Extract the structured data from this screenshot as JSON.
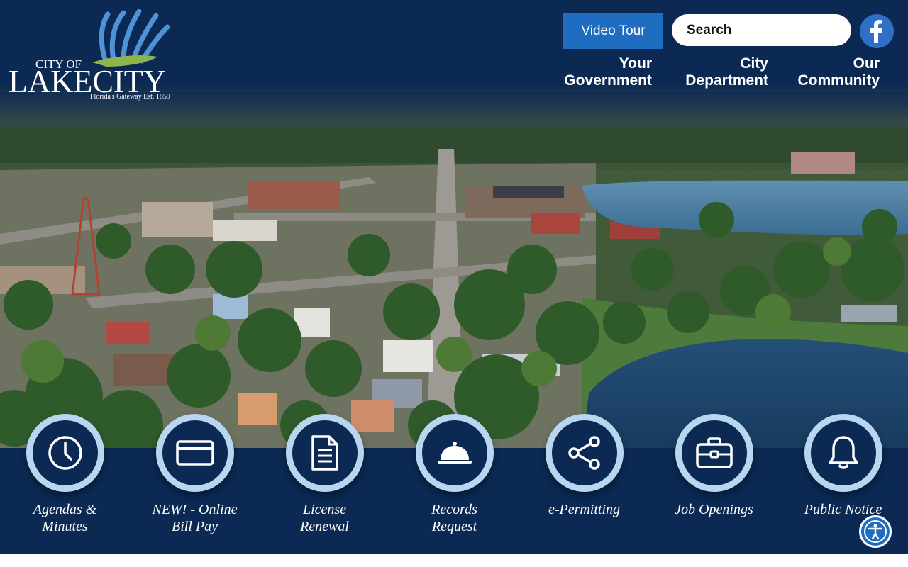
{
  "logo": {
    "line1": "CITY OF",
    "line2": "LAKECITY",
    "tagline": "Florida's Gateway Est. 1859"
  },
  "header": {
    "video_tour": "Video Tour",
    "search_placeholder": "Search",
    "facebook_icon": "facebook-icon",
    "search_icon": "search-icon"
  },
  "nav": [
    {
      "line1": "Your",
      "line2": "Government"
    },
    {
      "line1": "City",
      "line2": "Department"
    },
    {
      "line1": "Our",
      "line2": "Community"
    }
  ],
  "quick_links": [
    {
      "line1": "Agendas &",
      "line2": "Minutes",
      "icon": "clock-icon"
    },
    {
      "line1": "NEW! - Online",
      "line2": "Bill Pay",
      "icon": "credit-card-icon"
    },
    {
      "line1": "License",
      "line2": "Renewal",
      "icon": "document-icon"
    },
    {
      "line1": "Records",
      "line2": "Request",
      "icon": "service-bell-icon"
    },
    {
      "line1": "e-Permitting",
      "line2": "",
      "icon": "share-icon"
    },
    {
      "line1": "Job Openings",
      "line2": "",
      "icon": "briefcase-icon"
    },
    {
      "line1": "Public Notice",
      "line2": "",
      "icon": "bell-icon"
    }
  ],
  "accessibility_icon": "accessibility-icon",
  "colors": {
    "navy": "#0b2953",
    "accent_blue": "#1f6dc0",
    "ring_blue": "#b9d6f0",
    "facebook_blue": "#2f6fc6"
  }
}
